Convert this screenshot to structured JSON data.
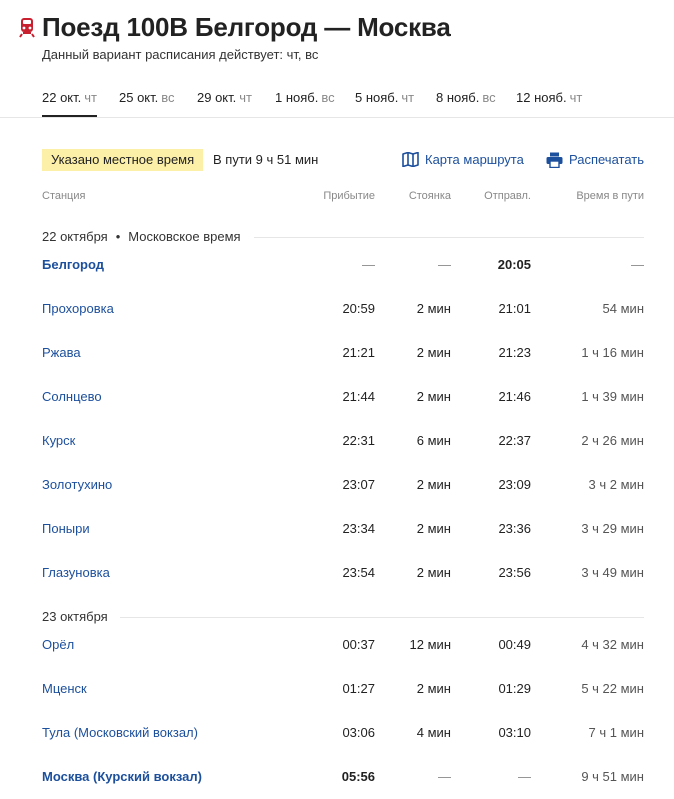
{
  "header": {
    "title": "Поезд 100В Белгород — Москва",
    "subtitle": "Данный вариант расписания действует: чт, вс",
    "brand_color": "#c8202f"
  },
  "tabs": [
    {
      "date": "22 окт.",
      "dow": "чт",
      "active": true
    },
    {
      "date": "25 окт.",
      "dow": "вс",
      "active": false
    },
    {
      "date": "29 окт.",
      "dow": "чт",
      "active": false
    },
    {
      "date": "1 нояб.",
      "dow": "вс",
      "active": false
    },
    {
      "date": "5 нояб.",
      "dow": "чт",
      "active": false
    },
    {
      "date": "8 нояб.",
      "dow": "вс",
      "active": false
    },
    {
      "date": "12 нояб.",
      "dow": "чт",
      "active": false
    }
  ],
  "info": {
    "local_time_badge": "Указано местное время",
    "travel_time": "В пути 9 ч 51 мин",
    "badge_color": "#fcefa8"
  },
  "actions": {
    "map_label": "Карта маршрута",
    "print_label": "Распечатать",
    "link_color": "#1c4f9c"
  },
  "columns": {
    "station": "Станция",
    "arrival": "Прибытие",
    "stop": "Стоянка",
    "departure": "Отправл.",
    "travel": "Время в пути"
  },
  "date_groups": [
    {
      "date": "22 октября",
      "timezone": "Московское время"
    },
    {
      "date": "23 октября",
      "timezone": ""
    }
  ],
  "stops": [
    {
      "station": "Белгород",
      "arrival": "—",
      "stop": "—",
      "departure": "20:05",
      "travel": "—"
    },
    {
      "station": "Прохоровка",
      "arrival": "20:59",
      "stop": "2 мин",
      "departure": "21:01",
      "travel": "54 мин"
    },
    {
      "station": "Ржава",
      "arrival": "21:21",
      "stop": "2 мин",
      "departure": "21:23",
      "travel": "1 ч 16 мин"
    },
    {
      "station": "Солнцево",
      "arrival": "21:44",
      "stop": "2 мин",
      "departure": "21:46",
      "travel": "1 ч 39 мин"
    },
    {
      "station": "Курск",
      "arrival": "22:31",
      "stop": "6 мин",
      "departure": "22:37",
      "travel": "2 ч 26 мин"
    },
    {
      "station": "Золотухино",
      "arrival": "23:07",
      "stop": "2 мин",
      "departure": "23:09",
      "travel": "3 ч 2 мин"
    },
    {
      "station": "Поныри",
      "arrival": "23:34",
      "stop": "2 мин",
      "departure": "23:36",
      "travel": "3 ч 29 мин"
    },
    {
      "station": "Глазуновка",
      "arrival": "23:54",
      "stop": "2 мин",
      "departure": "23:56",
      "travel": "3 ч 49 мин"
    },
    {
      "station": "Орёл",
      "arrival": "00:37",
      "stop": "12 мин",
      "departure": "00:49",
      "travel": "4 ч 32 мин"
    },
    {
      "station": "Мценск",
      "arrival": "01:27",
      "stop": "2 мин",
      "departure": "01:29",
      "travel": "5 ч 22 мин"
    },
    {
      "station": "Тула (Московский вокзал)",
      "arrival": "03:06",
      "stop": "4 мин",
      "departure": "03:10",
      "travel": "7 ч 1 мин"
    },
    {
      "station": "Москва (Курский вокзал)",
      "arrival": "05:56",
      "stop": "—",
      "departure": "—",
      "travel": "9 ч 51 мин"
    }
  ]
}
